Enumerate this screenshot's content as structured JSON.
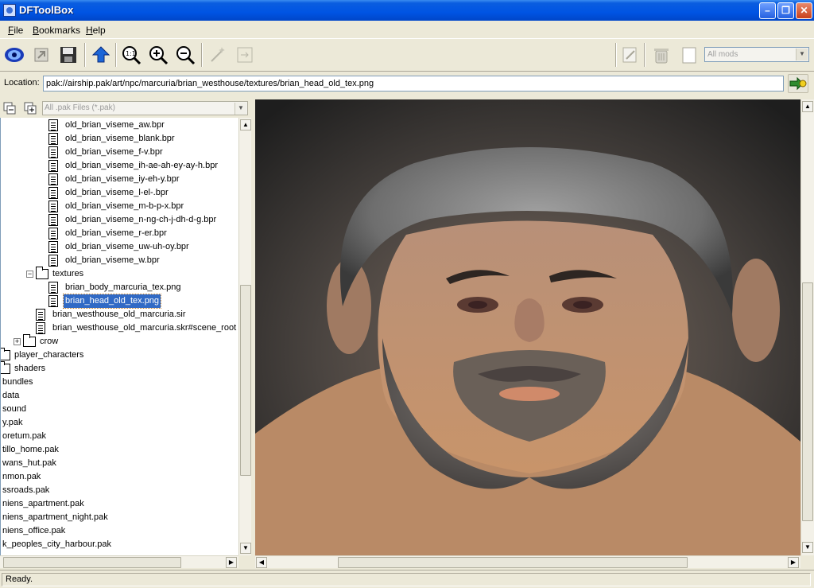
{
  "window": {
    "title": "DFToolBox"
  },
  "menu": [
    {
      "label": "File",
      "key": "F",
      "rest": "ile"
    },
    {
      "label": "Bookmarks",
      "key": "B",
      "rest": "ookmarks"
    },
    {
      "label": "Help",
      "key": "H",
      "rest": "elp"
    }
  ],
  "toolbar": {
    "buttons": [
      "eye-icon",
      "import-icon",
      "save-icon",
      "up-arrow-icon",
      "zoom-fit-icon",
      "zoom-in-icon",
      "zoom-out-icon",
      "wand-icon",
      "arrow-right-icon",
      "edit-icon",
      "trash-icon",
      "page-icon"
    ],
    "mods_select": "All mods"
  },
  "location": {
    "label": "Location:",
    "value": "pak://airship.pak/art/npc/marcuria/brian_westhouse/textures/brian_head_old_tex.png"
  },
  "left_panel": {
    "filter": "All .pak Files (*.pak)"
  },
  "tree": [
    {
      "label": "old_brian_viseme_aw.bpr",
      "type": "file",
      "indent": 4
    },
    {
      "label": "old_brian_viseme_blank.bpr",
      "type": "file",
      "indent": 4
    },
    {
      "label": "old_brian_viseme_f-v.bpr",
      "type": "file",
      "indent": 4
    },
    {
      "label": "old_brian_viseme_ih-ae-ah-ey-ay-h.bpr",
      "type": "file",
      "indent": 4
    },
    {
      "label": "old_brian_viseme_iy-eh-y.bpr",
      "type": "file",
      "indent": 4
    },
    {
      "label": "old_brian_viseme_l-el-.bpr",
      "type": "file",
      "indent": 4
    },
    {
      "label": "old_brian_viseme_m-b-p-x.bpr",
      "type": "file",
      "indent": 4
    },
    {
      "label": "old_brian_viseme_n-ng-ch-j-dh-d-g.bpr",
      "type": "file",
      "indent": 4
    },
    {
      "label": "old_brian_viseme_r-er.bpr",
      "type": "file",
      "indent": 4
    },
    {
      "label": "old_brian_viseme_uw-uh-oy.bpr",
      "type": "file",
      "indent": 4
    },
    {
      "label": "old_brian_viseme_w.bpr",
      "type": "file",
      "indent": 4
    },
    {
      "label": "textures",
      "type": "folder-open",
      "indent": 3
    },
    {
      "label": "brian_body_marcuria_tex.png",
      "type": "file",
      "indent": 4
    },
    {
      "label": "brian_head_old_tex.png",
      "type": "file",
      "indent": 4,
      "selected": true
    },
    {
      "label": "brian_westhouse_old_marcuria.sir",
      "type": "file",
      "indent": 3
    },
    {
      "label": "brian_westhouse_old_marcuria.skr#scene_root",
      "type": "file",
      "indent": 3
    },
    {
      "label": "crow",
      "type": "folder-closed",
      "indent": 2
    },
    {
      "label": "player_characters",
      "type": "folder",
      "indent": 0
    },
    {
      "label": "shaders",
      "type": "folder",
      "indent": 0
    },
    {
      "label": "bundles",
      "type": "text",
      "indent": 0
    },
    {
      "label": "data",
      "type": "text",
      "indent": 0
    },
    {
      "label": "sound",
      "type": "text",
      "indent": 0
    },
    {
      "label": "y.pak",
      "type": "text",
      "indent": 0
    },
    {
      "label": "oretum.pak",
      "type": "text",
      "indent": 0
    },
    {
      "label": "tillo_home.pak",
      "type": "text",
      "indent": 0
    },
    {
      "label": "wans_hut.pak",
      "type": "text",
      "indent": 0
    },
    {
      "label": "nmon.pak",
      "type": "text",
      "indent": 0
    },
    {
      "label": "ssroads.pak",
      "type": "text",
      "indent": 0
    },
    {
      "label": "niens_apartment.pak",
      "type": "text",
      "indent": 0
    },
    {
      "label": "niens_apartment_night.pak",
      "type": "text",
      "indent": 0
    },
    {
      "label": "niens_office.pak",
      "type": "text",
      "indent": 0
    },
    {
      "label": "k_peoples_city_harbour.pak",
      "type": "text",
      "indent": 0
    }
  ],
  "status": {
    "text": "Ready."
  },
  "colors": {
    "selection": "#316ac5",
    "titlebar": "#0054e3",
    "chrome": "#ece9d8"
  }
}
